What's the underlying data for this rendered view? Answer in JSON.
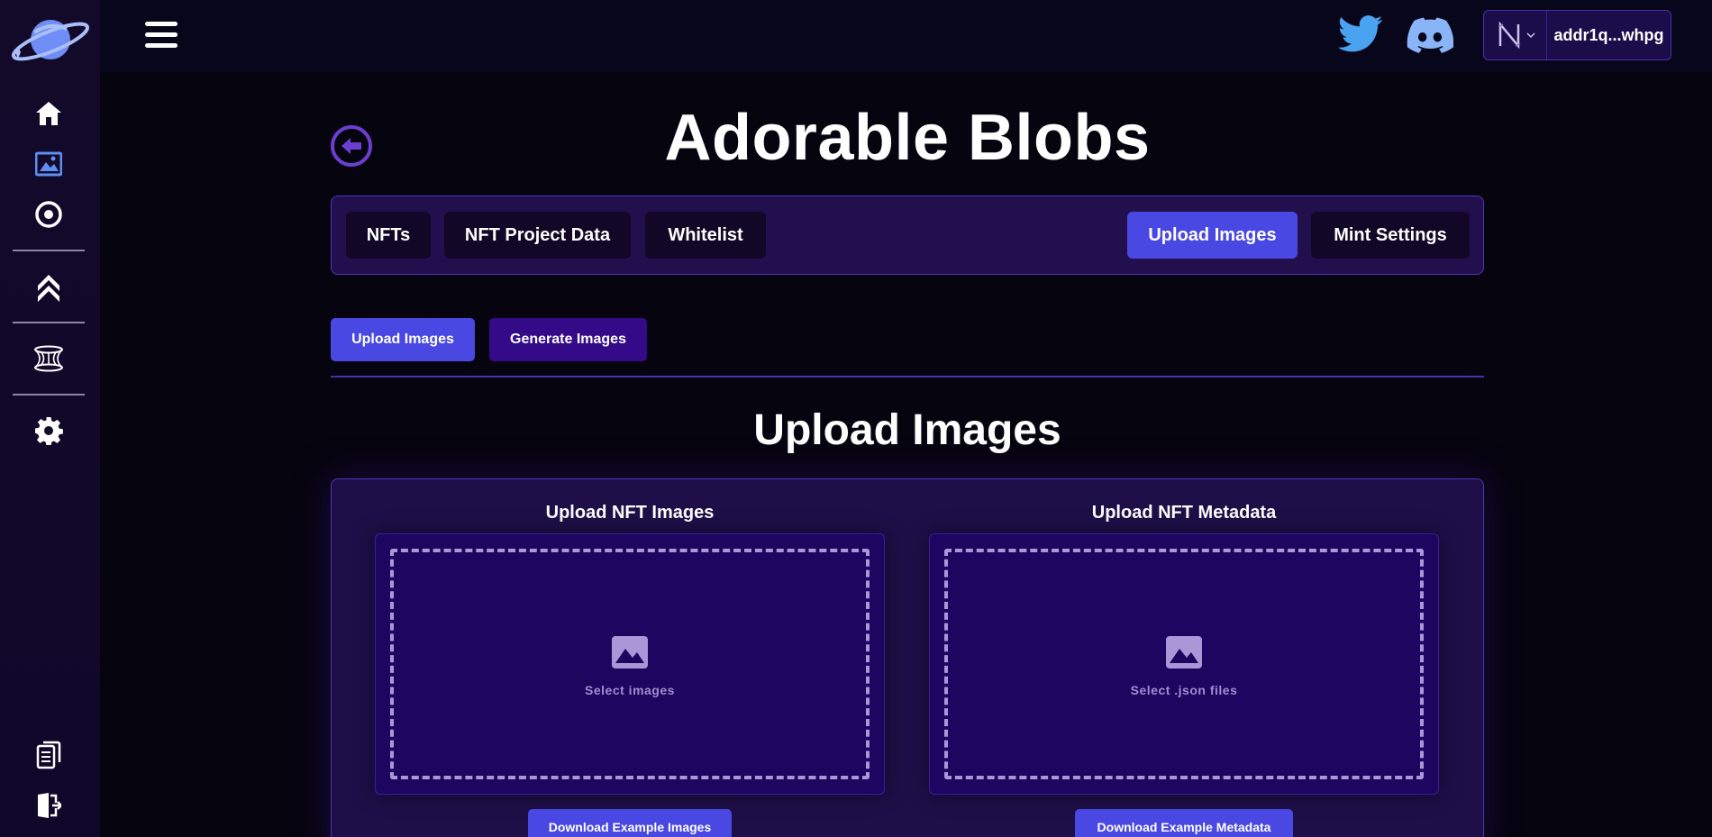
{
  "header": {
    "wallet_address": "addr1q...whpg"
  },
  "page": {
    "title": "Adorable Blobs"
  },
  "tabs": [
    {
      "label": "NFTs"
    },
    {
      "label": "NFT Project Data"
    },
    {
      "label": "Whitelist"
    },
    {
      "label": "Upload Images",
      "active": true
    },
    {
      "label": "Mint Settings"
    }
  ],
  "subtabs": [
    {
      "label": "Upload Images",
      "active": true
    },
    {
      "label": "Generate Images"
    }
  ],
  "section": {
    "title": "Upload Images"
  },
  "upload_images": {
    "title": "Upload NFT Images",
    "drop_label": "Select images",
    "download_label": "Download Example Images"
  },
  "upload_metadata": {
    "title": "Upload NFT Metadata",
    "drop_label": "Select .json files",
    "download_label": "Download Example Metadata"
  },
  "icons": {
    "sidebar": [
      "home-icon",
      "image-icon",
      "target-icon",
      "chevrons-up-icon",
      "portal-icon",
      "gear-icon",
      "documents-icon",
      "logout-icon"
    ],
    "header": [
      "menu-icon",
      "twitter-icon",
      "discord-icon",
      "wallet-icon"
    ]
  },
  "colors": {
    "accent": "#4a48e2",
    "background": "#06040f",
    "panel": "#1e0f48",
    "dropbox": "#1c0660",
    "twitter": "#4aa3f0",
    "discord": "#8ab4f8"
  }
}
